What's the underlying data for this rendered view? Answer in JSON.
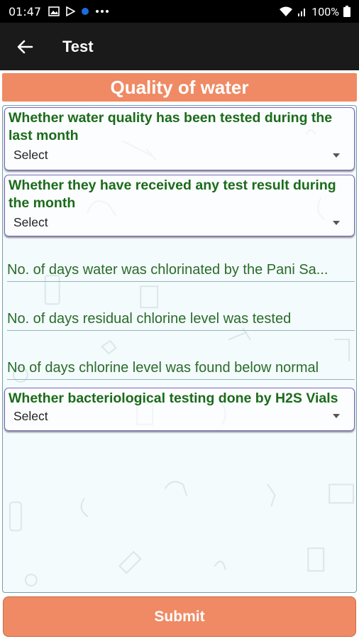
{
  "status_bar": {
    "time": "01:47",
    "battery": "100%",
    "icons": [
      "gallery-icon",
      "play-store-icon",
      "notification-dot-icon",
      "more-icon",
      "wifi-icon",
      "signal-icon",
      "battery-icon"
    ]
  },
  "app_bar": {
    "title": "Test",
    "back_icon": "arrow-left-icon"
  },
  "section": {
    "title": "Quality of water"
  },
  "questions": [
    {
      "label": "Whether water quality has been tested during the last month",
      "value": "Select"
    },
    {
      "label": "Whether they have received any test result during the month",
      "value": "Select"
    },
    {
      "label": "Whether bacteriological testing done by H2S Vials",
      "value": "Select"
    }
  ],
  "fields": [
    {
      "placeholder": "No. of days water was chlorinated by the Pani Sa..."
    },
    {
      "placeholder": "No. of days residual chlorine level was tested"
    },
    {
      "placeholder": "No of days chlorine level was found below normal"
    }
  ],
  "submit": {
    "label": "Submit"
  },
  "colors": {
    "accent": "#ef8a64",
    "label_green": "#1b6b1b",
    "card_border": "#7a66c4"
  }
}
